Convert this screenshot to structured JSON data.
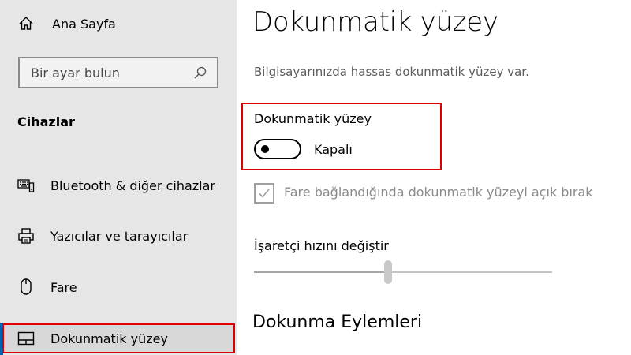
{
  "sidebar": {
    "home_label": "Ana Sayfa",
    "search_placeholder": "Bir ayar bulun",
    "section_title": "Cihazlar",
    "items": [
      {
        "label": "Bluetooth & diğer cihazlar",
        "icon": "bluetooth-devices-icon"
      },
      {
        "label": "Yazıcılar ve tarayıcılar",
        "icon": "printer-icon"
      },
      {
        "label": "Fare",
        "icon": "mouse-icon"
      },
      {
        "label": "Dokunmatik yüzey",
        "icon": "touchpad-icon",
        "active": true
      }
    ]
  },
  "main": {
    "title": "Dokunmatik yüzey",
    "description": "Bilgisayarınızda hassas dokunmatik yüzey var.",
    "touchpad_toggle": {
      "label": "Dokunmatik yüzey",
      "state_label": "Kapalı",
      "on": false
    },
    "leave_on_checkbox": {
      "label": "Fare bağlandığında dokunmatik yüzeyi açık bırak",
      "checked": true,
      "disabled": true
    },
    "pointer_speed": {
      "label": "İşaretçi hızını değiştir",
      "value_fraction": 0.45
    },
    "taps_heading": "Dokunma Eylemleri"
  },
  "colors": {
    "accent": "#0063b1",
    "highlight_border": "#e00000",
    "sidebar_bg": "#e6e6e6"
  }
}
